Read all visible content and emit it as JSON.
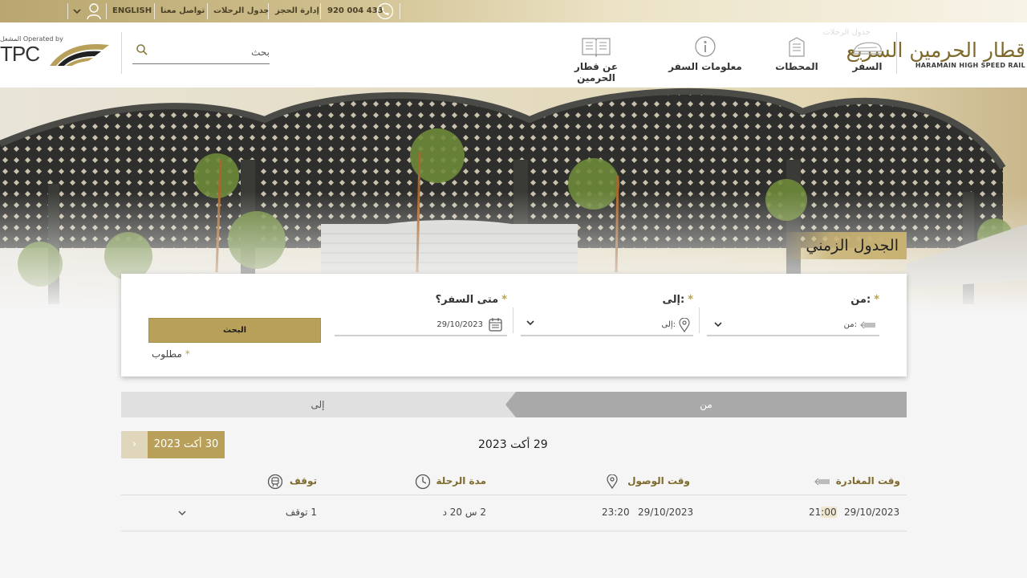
{
  "topbar": {
    "phone": "920 004 433",
    "manage_booking": "إدارة الحجز",
    "timetable": "جدول الرحلات",
    "contact": "تواصل معنا",
    "language": "ENGLISH"
  },
  "header": {
    "logo_ar": "قطار الحرمين السريع",
    "logo_en": "HARAMAIN HIGH SPEED RAIL",
    "ghost_text": "جدول الرحلات",
    "nav": {
      "travel": "السفر",
      "stations": "المحطات",
      "travel_info": "معلومات السفر",
      "about": "عن قطار الحرمين"
    },
    "search_placeholder": "بحث",
    "operator_by": "المشغل Operated by",
    "operator_name": "TPC"
  },
  "page_title": "الجدول الزمني",
  "form": {
    "from_label": ":من",
    "from_placeholder": ":من",
    "to_label": ":إلى",
    "to_placeholder": ":إلى",
    "when_label": "متى السفر؟",
    "date_value": "29/10/2023",
    "search_button": "البحث",
    "required_note": "مطلوب"
  },
  "tabs": {
    "from": "من",
    "to": "إلى"
  },
  "next_day": "30 أكت 2023",
  "current_date": "29 أكت 2023",
  "table": {
    "headers": {
      "departure": "وقت المغادرة",
      "arrival": "وقت الوصول",
      "duration": "مدة الرحلة",
      "stops": "توقف"
    },
    "rows": [
      {
        "dep_date": "29/10/2023",
        "dep_time_h": "21",
        "dep_time_sep": ":",
        "dep_time_m": "00",
        "arr_date": "29/10/2023",
        "arr_time": "23:20",
        "duration": "2 س 20 د",
        "stops": "1 توقف"
      }
    ]
  },
  "colors": {
    "gold": "#b9a05a",
    "gold_dark": "#7d6a2c",
    "tab_active": "#a9a9a9",
    "tab_inactive": "#e0e0e0"
  }
}
